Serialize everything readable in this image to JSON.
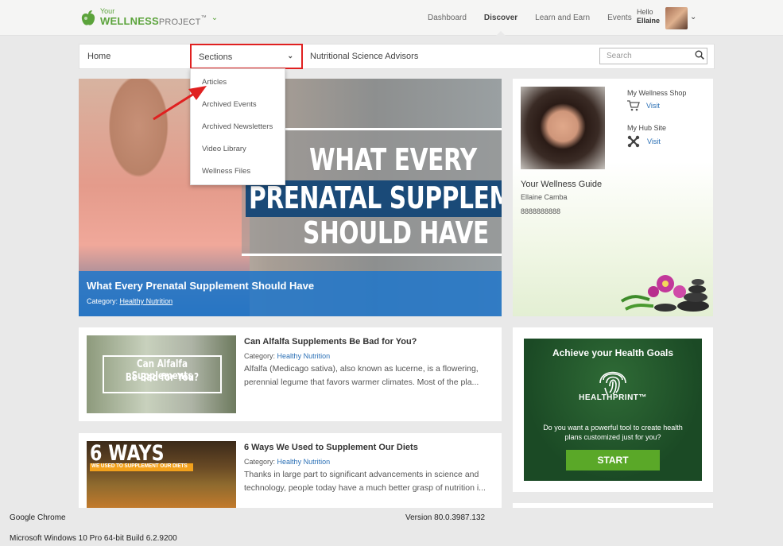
{
  "logo": {
    "small": "Your",
    "main": "WELLNESS",
    "suffix": "PROJECT",
    "tm": "™"
  },
  "nav": {
    "items": [
      {
        "label": "Dashboard"
      },
      {
        "label": "Discover"
      },
      {
        "label": "Learn and Earn"
      },
      {
        "label": "Events"
      }
    ],
    "active": "Discover",
    "user": {
      "greeting": "Hello",
      "name": "Ellaine"
    }
  },
  "subnav": {
    "home": "Home",
    "sections": "Sections",
    "advisors": "Nutritional Science Advisors",
    "search_placeholder": "Search"
  },
  "dropdown": {
    "items": [
      "Articles",
      "Archived Events",
      "Archived Newsletters",
      "Video Library",
      "Wellness Files"
    ]
  },
  "hero": {
    "image_text": [
      "WHAT EVERY",
      "PRENATAL SUPPLEMENT",
      "SHOULD HAVE"
    ],
    "title": "What Every Prenatal Supplement Should Have",
    "category_label": "Category:",
    "category": "Healthy Nutrition"
  },
  "profile": {
    "guide_label": "Your Wellness Guide",
    "guide_name": "Ellaine Camba",
    "phone": "8888888888",
    "shop_label": "My Wellness Shop",
    "shop_link": "Visit",
    "hub_label": "My Hub Site",
    "hub_link": "Visit"
  },
  "articles": [
    {
      "thumb_text": [
        "Can Alfalfa Supplements",
        "Be Bad for You?"
      ],
      "title": "Can Alfalfa Supplements Be Bad for You?",
      "category_label": "Category:",
      "category": "Healthy Nutrition",
      "excerpt": "Alfalfa (Medicago sativa), also known as lucerne, is a flowering, perennial legume that favors warmer climates. Most of the pla..."
    },
    {
      "thumb_text": [
        "6 WAYS",
        "WE USED TO SUPPLEMENT OUR DIETS"
      ],
      "title": "6 Ways We Used to Supplement Our Diets",
      "category_label": "Category:",
      "category": "Healthy Nutrition",
      "excerpt": "Thanks in large part to significant advancements in science and technology, people today have a much better grasp of nutrition i..."
    }
  ],
  "ad": {
    "heading": "Achieve your Health Goals",
    "brand": "HEALTHPRINT™",
    "text": "Do you want a powerful tool to create health plans customized just for you?",
    "button": "START"
  },
  "system": {
    "app": "Google Chrome",
    "version": "Version 80.0.3987.132",
    "os": "Microsoft Windows 10 Pro 64-bit Build 6.2.9200"
  },
  "colors": {
    "brand_green": "#5ba33b",
    "link_blue": "#2a6fb5",
    "highlight_red": "#e02020",
    "caption_blue": "#2276c8",
    "ad_green": "#1b4a25",
    "button_green": "#5aa828"
  }
}
